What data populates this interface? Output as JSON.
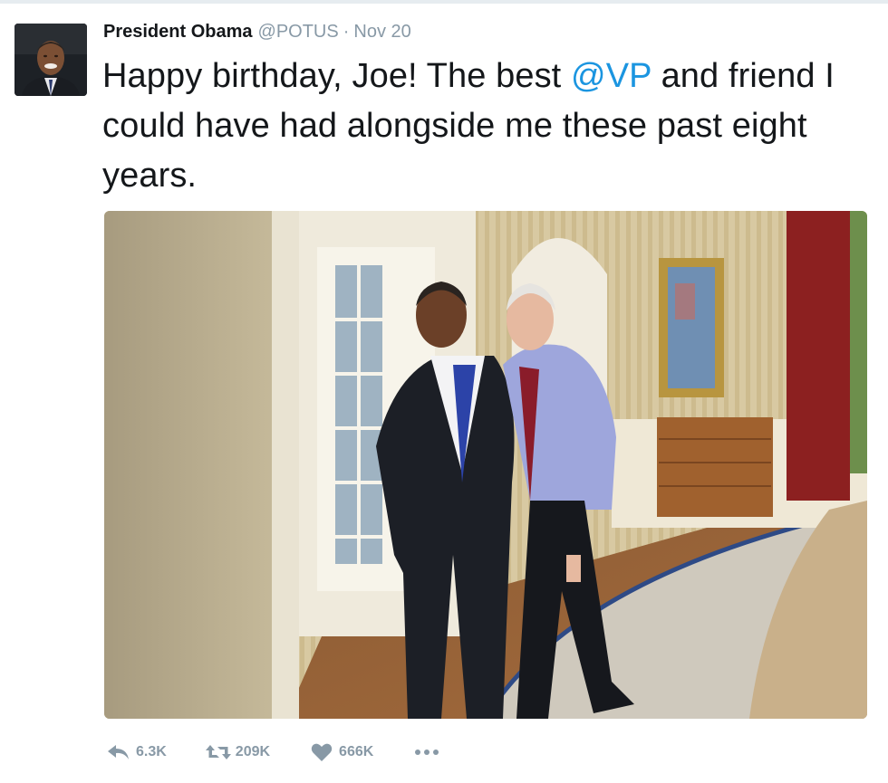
{
  "tweet": {
    "author_name": "President Obama",
    "handle": "@POTUS",
    "separator": "·",
    "date": "Nov 20",
    "text_before": "Happy birthday, Joe! The best ",
    "mention": "@VP",
    "text_after": " and friend I could have had alongside me these past eight years.",
    "mention_color": "#1b95e0"
  },
  "actions": {
    "reply_icon": "reply-icon",
    "reply_count": "6.3K",
    "retweet_icon": "retweet-icon",
    "retweet_count": "209K",
    "like_icon": "heart-icon",
    "like_count": "666K",
    "more_icon": "more-dots-icon"
  },
  "colors": {
    "text": "#14171a",
    "muted": "#8899a6",
    "link": "#1b95e0"
  }
}
